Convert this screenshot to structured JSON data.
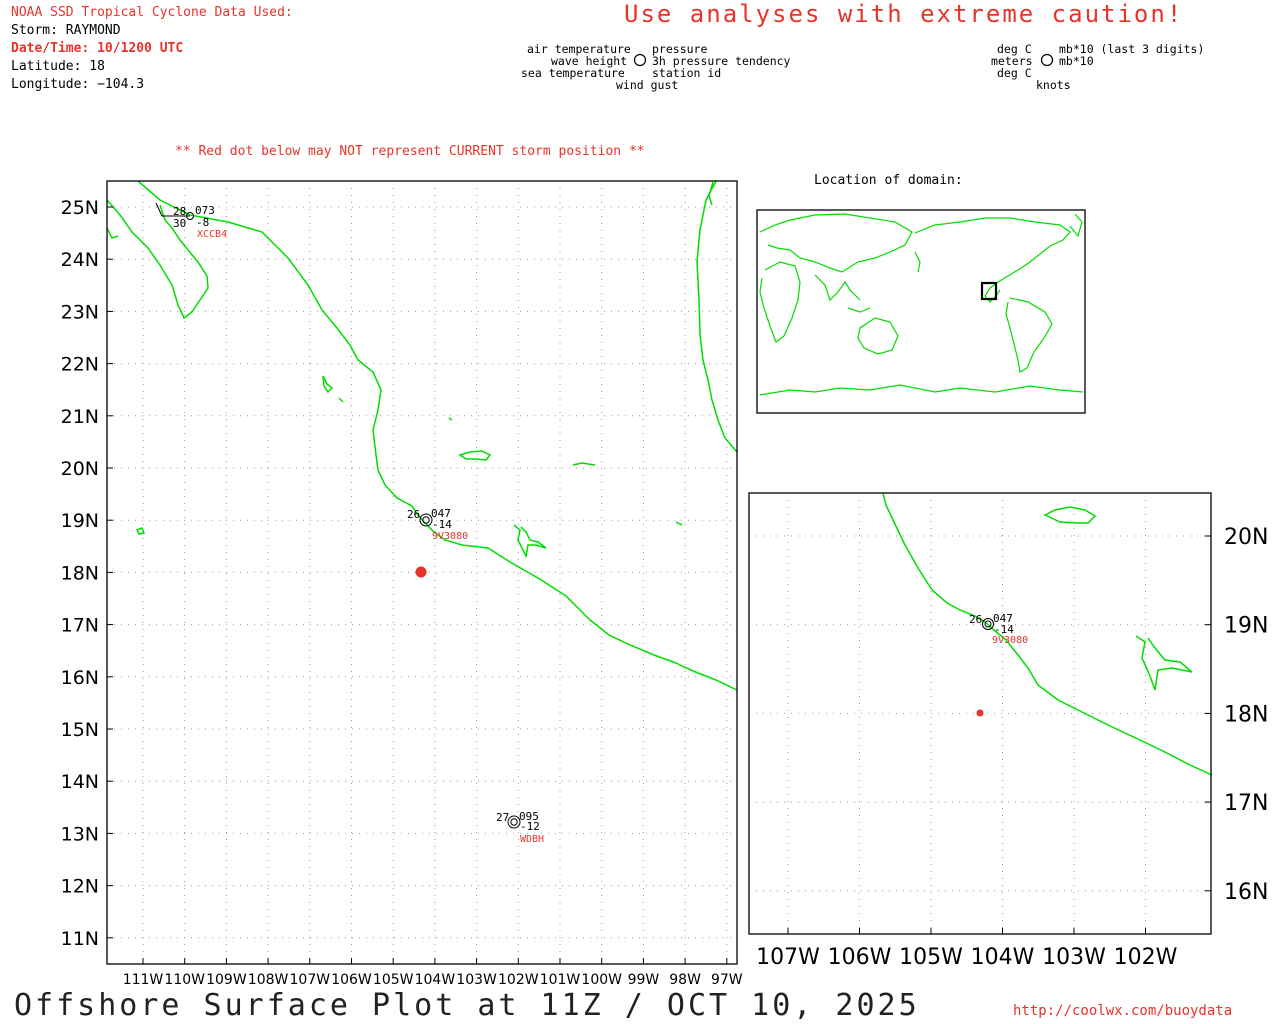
{
  "header": {
    "source_line": "NOAA SSD Tropical Cyclone Data Used:",
    "storm_line": "Storm: RAYMOND",
    "datetime_line": "Date/Time: 10/1200 UTC",
    "lat_line": "Latitude: 18",
    "lon_line": "Longitude: −104.3",
    "caution": "Use analyses with extreme caution!"
  },
  "legend": {
    "left_air": "air temperature",
    "left_wave": "wave height",
    "left_sea": "sea temperature",
    "right_pressure": "pressure",
    "right_tendency": "3h pressure tendency",
    "right_station": "station id",
    "bottom_gust": "wind gust",
    "units_left1": "deg C",
    "units_left2": "meters",
    "units_left3": "deg C",
    "units_right1": "mb*10 (last 3 digits)",
    "units_right2": "mb*10",
    "units_bottom": "knots"
  },
  "notice": "** Red dot below may NOT represent CURRENT storm position **",
  "inset_title": "Location of domain:",
  "main_map": {
    "lat_labels": [
      "25N",
      "24N",
      "23N",
      "22N",
      "21N",
      "20N",
      "19N",
      "18N",
      "17N",
      "16N",
      "15N",
      "14N",
      "13N",
      "12N",
      "11N"
    ],
    "lon_labels": [
      "111W",
      "110W",
      "109W",
      "108W",
      "107W",
      "106W",
      "105W",
      "104W",
      "103W",
      "102W",
      "101W",
      "100W",
      "99W",
      "98W",
      "97W"
    ]
  },
  "zoom_map": {
    "lat_labels": [
      "20N",
      "19N",
      "18N",
      "17N",
      "16N"
    ],
    "lon_labels": [
      "107W",
      "106W",
      "105W",
      "104W",
      "103W",
      "102W"
    ]
  },
  "stations": [
    {
      "id": "XCCB4",
      "air": "28",
      "pressure": "073",
      "sea": "30",
      "tendency": "-8"
    },
    {
      "id": "9V3080",
      "air": "26",
      "pressure": "047",
      "sea": "",
      "tendency": "-14"
    },
    {
      "id": "WDBH",
      "air": "27",
      "pressure": "095",
      "sea": "",
      "tendency": "-12"
    }
  ],
  "storm_position": {
    "lat": 18.0,
    "lon": -104.3
  },
  "footer": {
    "title": "Offshore Surface Plot at 11Z / OCT 10, 2025",
    "url": "http://coolwx.com/buoydata"
  },
  "colors": {
    "coast": "#00dd00",
    "red": "#e8332a",
    "grid": "#999999"
  }
}
